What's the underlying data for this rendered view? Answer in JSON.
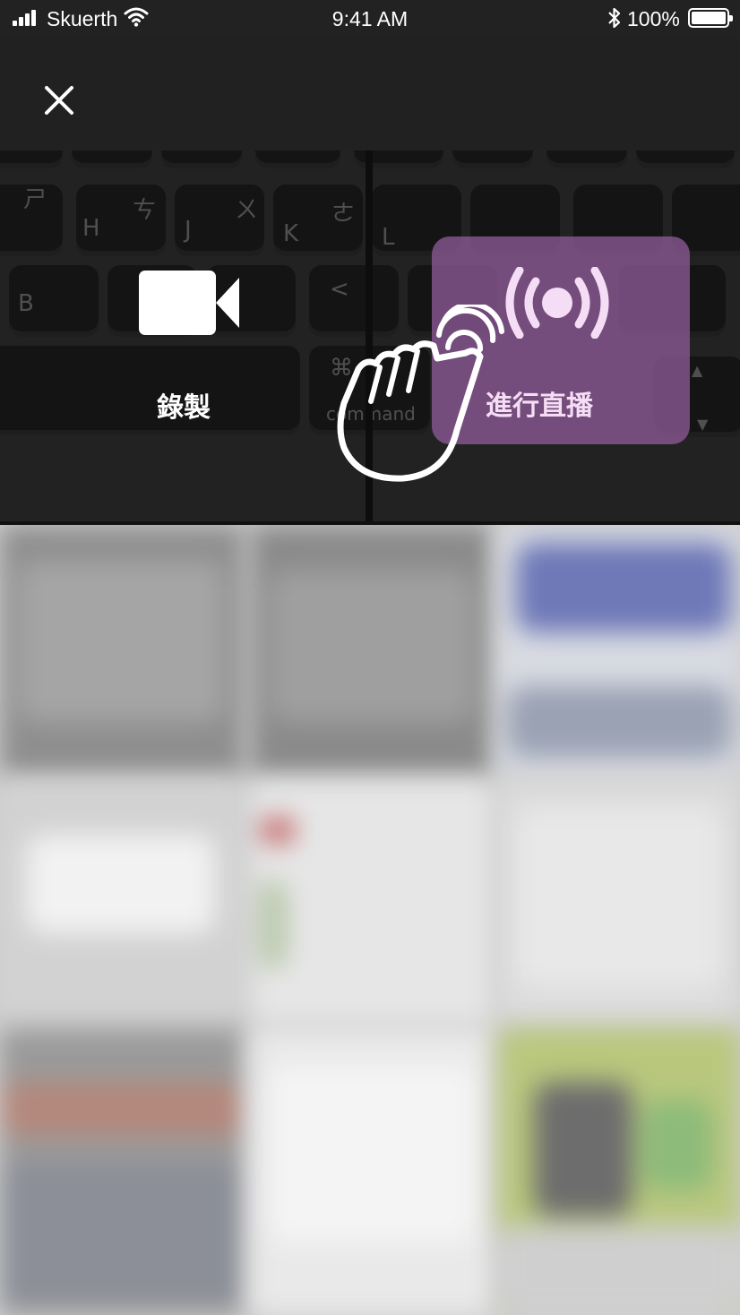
{
  "status_bar": {
    "carrier": "Skuerth",
    "time": "9:41 AM",
    "battery": "100%",
    "icons": [
      "signal-icon",
      "wifi-icon",
      "bluetooth-icon",
      "battery-icon"
    ]
  },
  "header": {
    "close_icon": "close-icon"
  },
  "modes": {
    "record": {
      "label": "錄製",
      "icon": "video-camera-icon"
    },
    "live": {
      "label": "進行直播",
      "icon": "broadcast-icon",
      "selected": true
    }
  },
  "gesture": {
    "icon": "tap-hand-icon"
  },
  "colors": {
    "live_highlight": "#8c5a96",
    "live_text": "#f6ddf6",
    "header_bg": "#212121"
  }
}
